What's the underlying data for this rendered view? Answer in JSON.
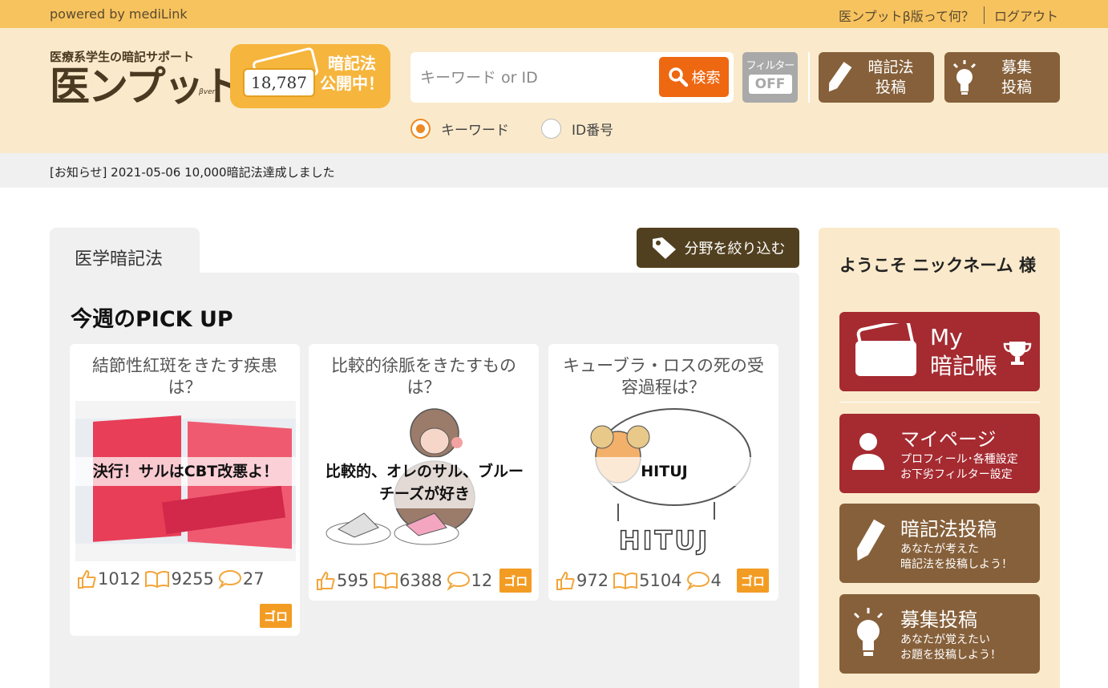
{
  "topbar": {
    "powered": "powered by mediLink",
    "link_about": "医ンプットβ版って何？",
    "link_logout": "ログアウト"
  },
  "logo": {
    "tagline": "医療系学生の暗記サポート",
    "name": "医ンプット",
    "beta": "βver"
  },
  "counter": {
    "count": "18,787",
    "label_line1": "暗記法",
    "label_line2": "公開中！"
  },
  "search": {
    "placeholder": "キーワード or ID",
    "button": "検索",
    "mode_keyword": "キーワード",
    "mode_id": "ID番号",
    "selected": "キーワード"
  },
  "filter": {
    "label": "フィルター",
    "state": "OFF"
  },
  "header_buttons": {
    "post_line1": "暗記法",
    "post_line2": "投稿",
    "recruit_line1": "募集",
    "recruit_line2": "投稿"
  },
  "notice": "[お知らせ] 2021-05-06 10,000暗記法達成しました",
  "main": {
    "tab": "医学暗記法",
    "narrow_button": "分野を絞り込む",
    "pickup_title": "今週のPICK UP",
    "cards": [
      {
        "title": "結節性紅斑をきたす疾患は？",
        "overlay": "決行！サルはCBT改悪よ！",
        "likes": "1012",
        "views": "9255",
        "comments": "27",
        "badge": "ゴロ"
      },
      {
        "title": "比較的徐脈をきたすものは？",
        "overlay": "比較的、オレのサル、ブルーチーズが好き",
        "likes": "595",
        "views": "6388",
        "comments": "12",
        "badge": "ゴロ"
      },
      {
        "title": "キューブラ・ロスの死の受容過程は？",
        "overlay": "HITUJ",
        "likes": "972",
        "views": "5104",
        "comments": "4",
        "badge": "ゴロ",
        "image_text": "HITUJ"
      }
    ]
  },
  "sidebar": {
    "welcome": "ようこそ ニックネーム 様",
    "my_notebook_line1": "My",
    "my_notebook_line2": "暗記帳",
    "mypage_title": "マイページ",
    "mypage_sub1": "プロフィール･各種設定",
    "mypage_sub2": "お下劣フィルター設定",
    "post_title": "暗記法投稿",
    "post_sub1": "あなたが考えた",
    "post_sub2": "暗記法を投稿しよう！",
    "recruit_title": "募集投稿",
    "recruit_sub1": "あなたが覚えたい",
    "recruit_sub2": "お題を投稿しよう！"
  },
  "colors": {
    "topbar": "#f7c35f",
    "header": "#faeacb",
    "search_button": "#ee6711",
    "brown_button": "#86603a",
    "red_button": "#a52b31",
    "badge": "#f39c23"
  }
}
